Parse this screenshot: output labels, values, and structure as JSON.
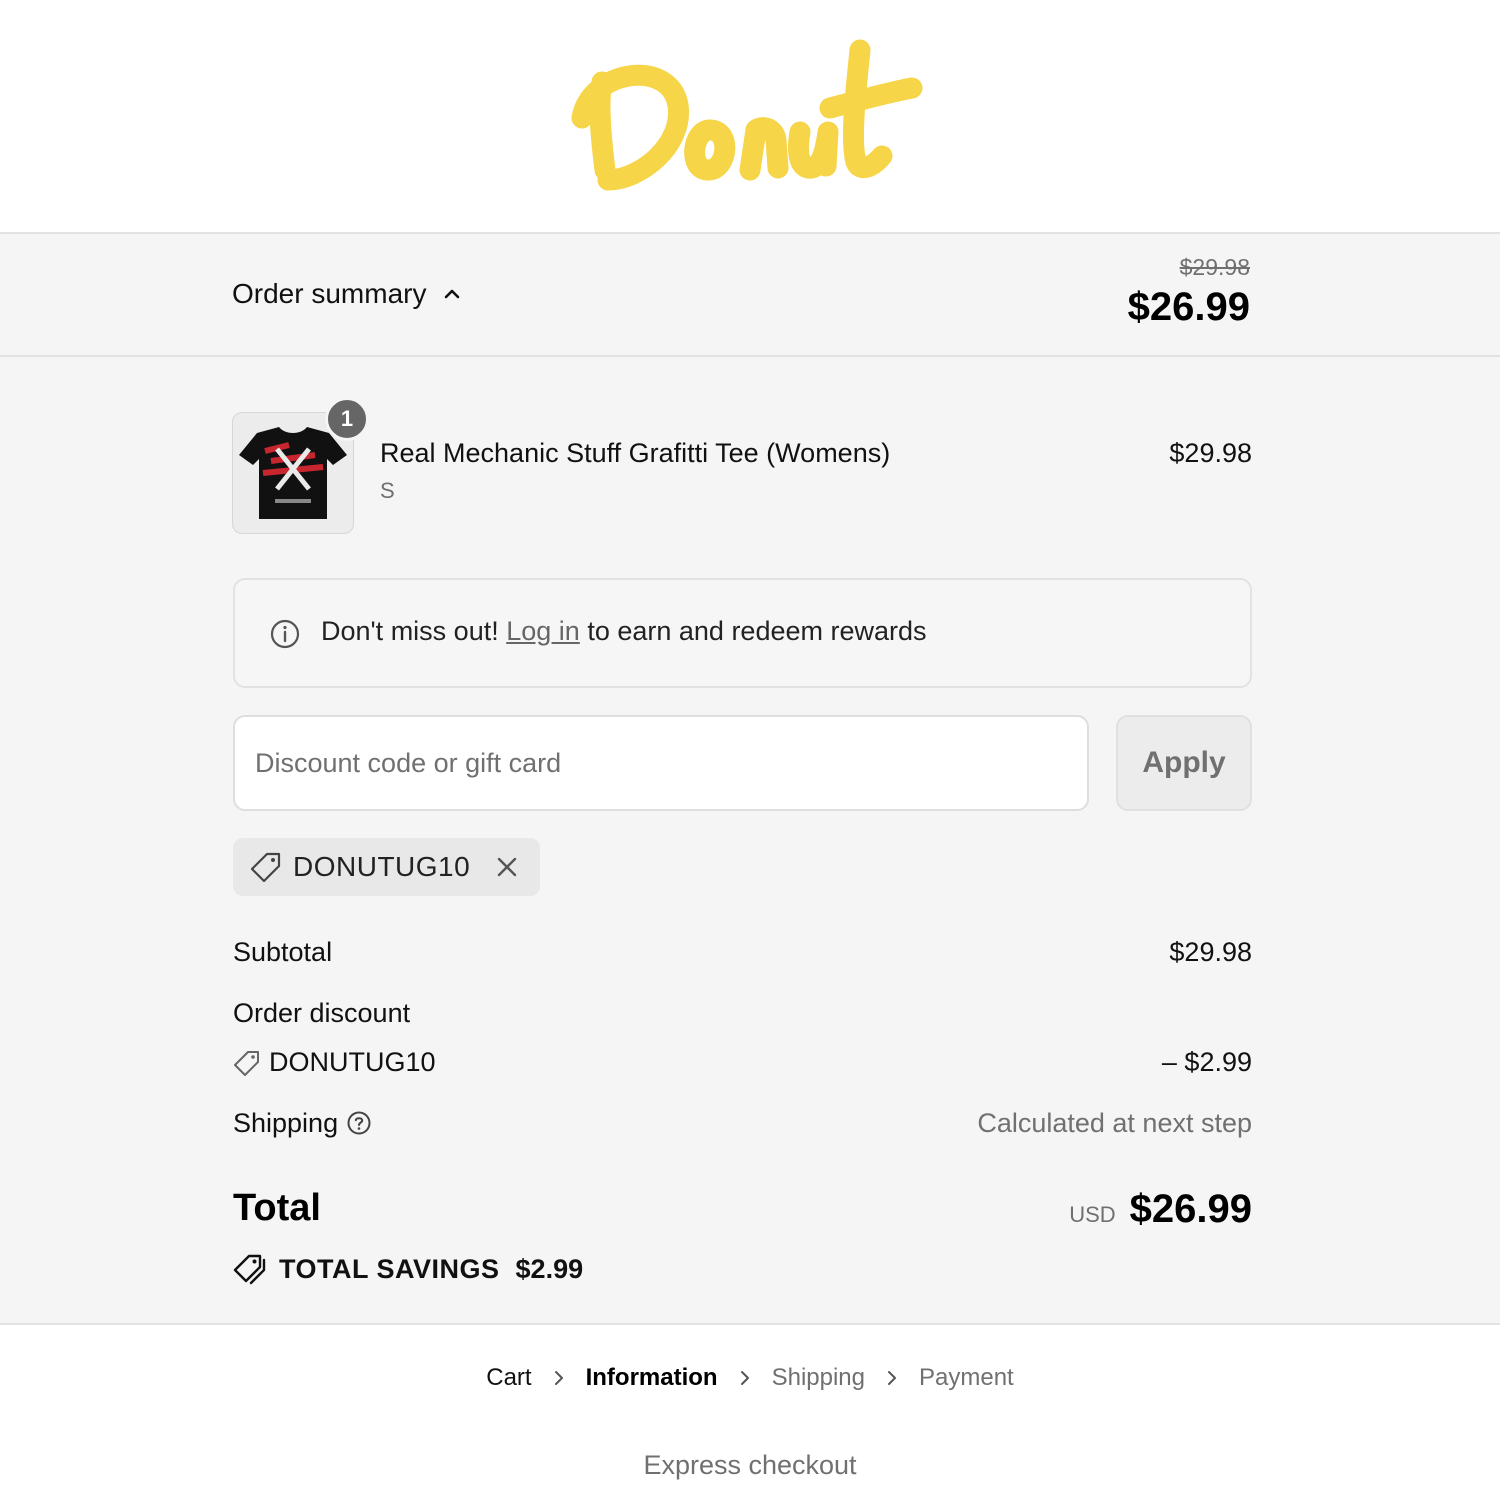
{
  "brand": {
    "logo_text": "Donut",
    "logo_color": "#f6d548"
  },
  "summary": {
    "toggle_label": "Order summary",
    "original_total": "$29.98",
    "total": "$26.99"
  },
  "product": {
    "quantity": "1",
    "name": "Real Mechanic Stuff Grafitti Tee (Womens)",
    "variant": "S",
    "price": "$29.98"
  },
  "rewards": {
    "prefix": "Don't miss out!",
    "link": "Log in",
    "suffix": "to earn and redeem rewards"
  },
  "discount": {
    "placeholder": "Discount code or gift card",
    "apply_label": "Apply",
    "applied_code": "DONUTUG10"
  },
  "totals": {
    "subtotal_label": "Subtotal",
    "subtotal_value": "$29.98",
    "discount_label": "Order discount",
    "discount_code": "DONUTUG10",
    "discount_value": "– $2.99",
    "shipping_label": "Shipping",
    "shipping_value": "Calculated at next step",
    "total_label": "Total",
    "currency": "USD",
    "total_value": "$26.99",
    "savings_label": "TOTAL SAVINGS",
    "savings_value": "$2.99"
  },
  "breadcrumb": {
    "items": [
      "Cart",
      "Information",
      "Shipping",
      "Payment"
    ],
    "active": "Information"
  },
  "express_checkout": "Express checkout",
  "colors": {
    "accent_yellow": "#f6d548",
    "panel_bg": "#f5f5f5",
    "muted_text": "#707070"
  }
}
